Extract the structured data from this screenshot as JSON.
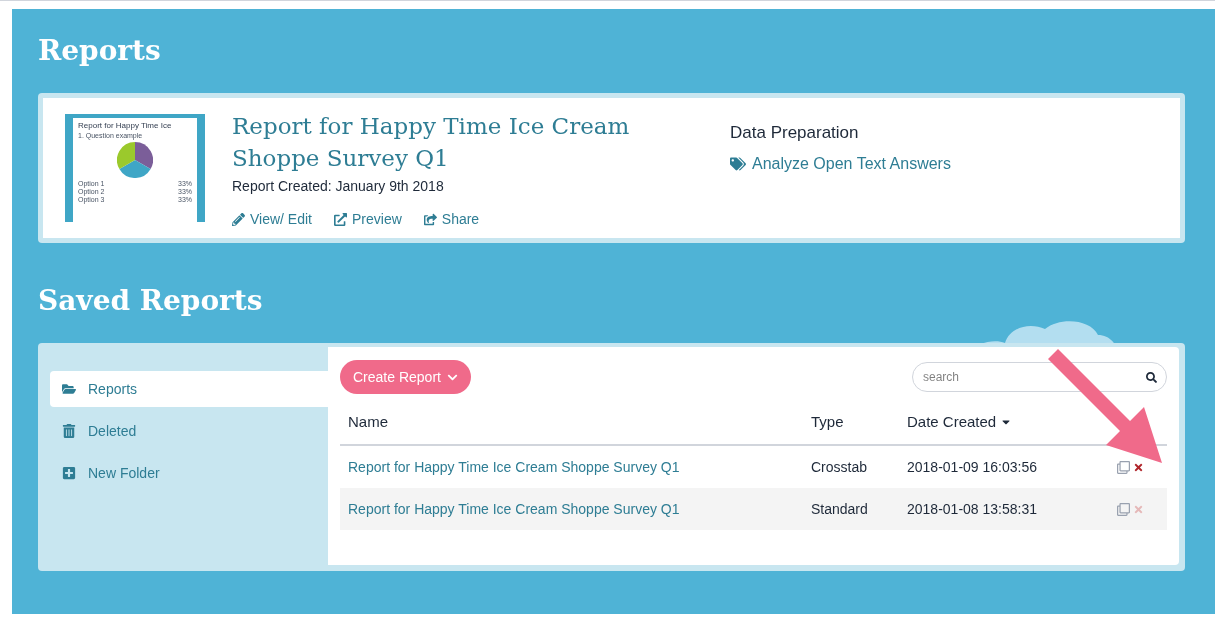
{
  "page_title": "Reports",
  "featured_report": {
    "thumbnail": {
      "title": "Report for Happy Time Ice",
      "question": "1. Question example",
      "options": [
        {
          "label": "Option 1",
          "value": "33%"
        },
        {
          "label": "Option 2",
          "value": "33%"
        },
        {
          "label": "Option 3",
          "value": "33%"
        }
      ]
    },
    "title": "Report for Happy Time Ice Cream Shoppe Survey Q1",
    "created": "Report Created: January 9th 2018",
    "actions": [
      {
        "kind": "edit",
        "label": "View/ Edit"
      },
      {
        "kind": "preview",
        "label": "Preview"
      },
      {
        "kind": "share",
        "label": "Share"
      }
    ],
    "data_preparation": {
      "heading": "Data Preparation",
      "link": "Analyze Open Text Answers"
    }
  },
  "saved_title": "Saved Reports",
  "sidebar": {
    "items": [
      {
        "kind": "folder",
        "label": "Reports",
        "selected": true
      },
      {
        "kind": "trash",
        "label": "Deleted",
        "selected": false
      },
      {
        "kind": "add",
        "label": "New Folder",
        "selected": false
      }
    ]
  },
  "create_button": "Create Report",
  "search": {
    "placeholder": "search"
  },
  "table": {
    "columns": [
      "Name",
      "Type",
      "Date Created"
    ],
    "rows": [
      {
        "name": "Report for Happy Time Ice Cream Shoppe Survey Q1",
        "type": "Crosstab",
        "date": "2018-01-09 16:03:56",
        "delete_disabled": false
      },
      {
        "name": "Report for Happy Time Ice Cream Shoppe Survey Q1",
        "type": "Standard",
        "date": "2018-01-08 13:58:31",
        "delete_disabled": true
      }
    ]
  }
}
